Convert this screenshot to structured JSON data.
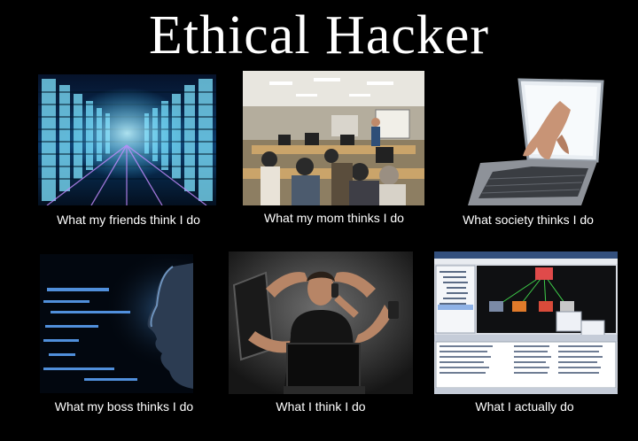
{
  "title": "Ethical Hacker",
  "panels": [
    {
      "caption": "What my friends think I do",
      "image": "matrix-data-corridor"
    },
    {
      "caption": "What my mom thinks I do",
      "image": "computer-classroom-photo"
    },
    {
      "caption": "What society thinks I do",
      "image": "hand-through-laptop-screen"
    },
    {
      "caption": "What my boss thinks I do",
      "image": "code-reflected-on-face"
    },
    {
      "caption": "What I think I do",
      "image": "multitasking-man-with-devices"
    },
    {
      "caption": "What I actually do",
      "image": "network-software-screenshot"
    }
  ]
}
